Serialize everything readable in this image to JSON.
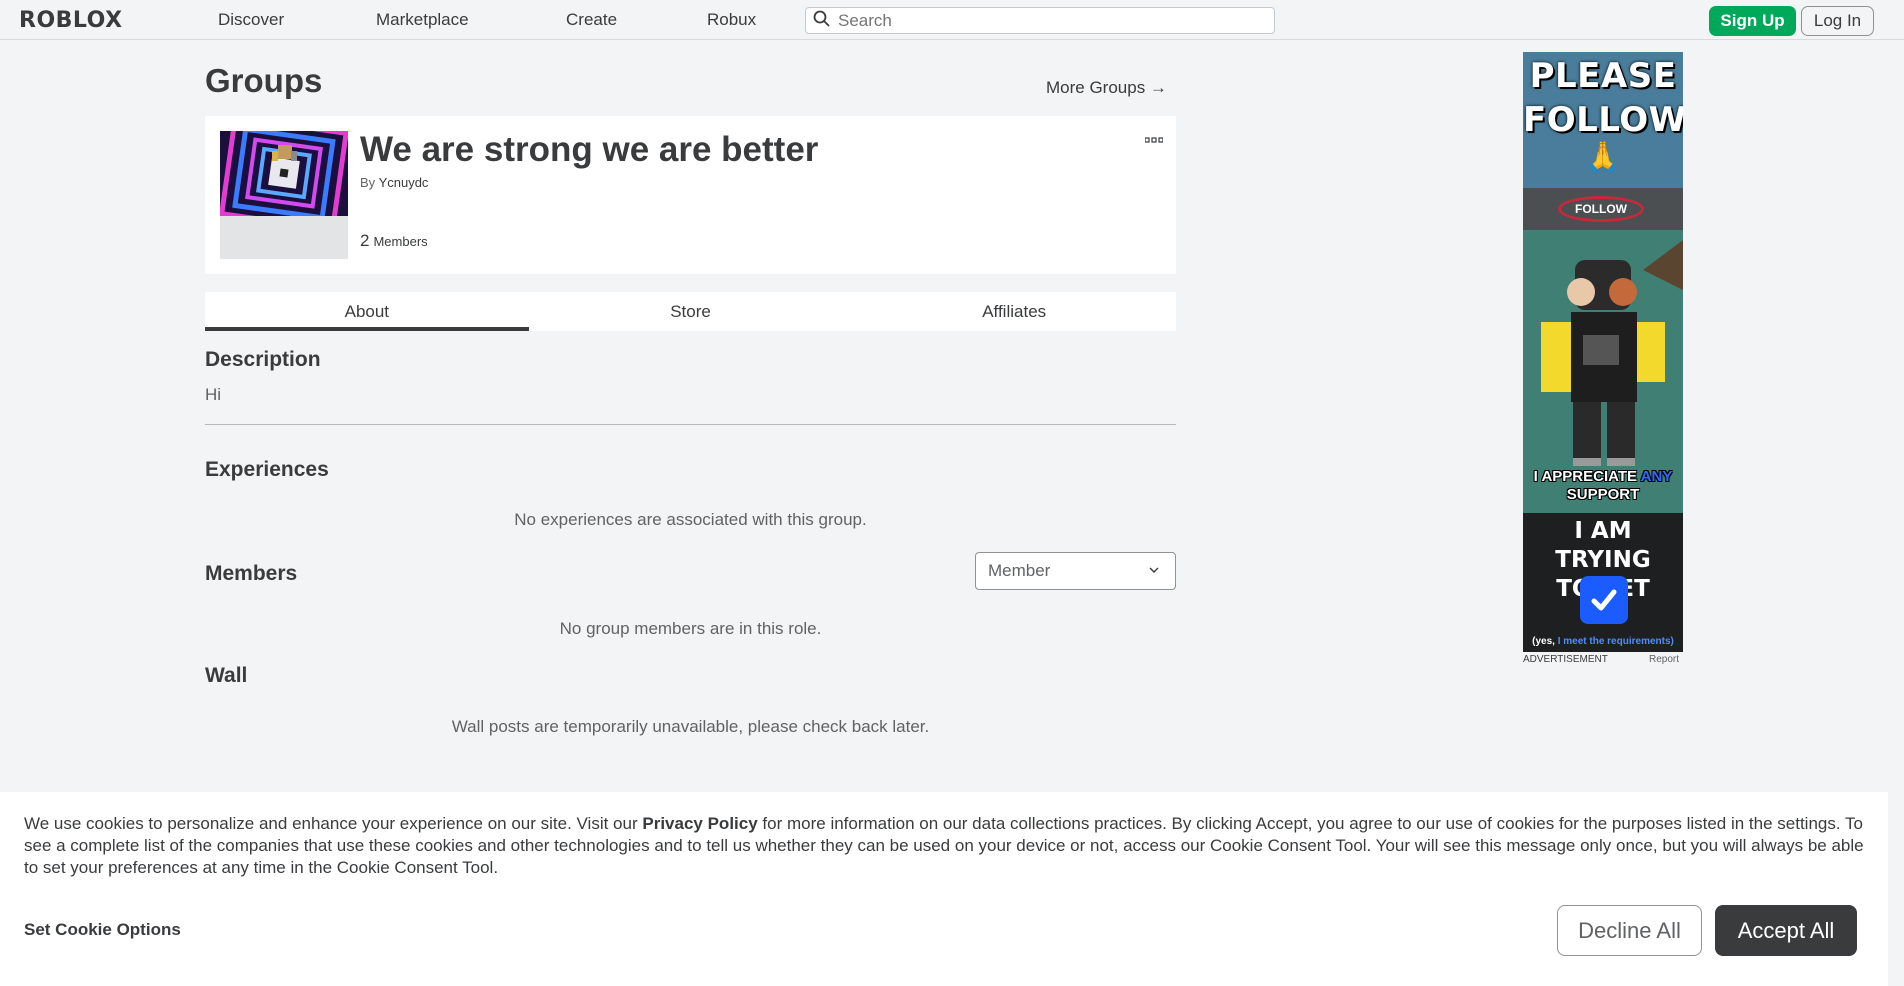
{
  "header": {
    "logo": "ROBLOX",
    "nav": [
      "Discover",
      "Marketplace",
      "Create",
      "Robux"
    ],
    "search_placeholder": "Search",
    "signup_label": "Sign Up",
    "login_label": "Log In"
  },
  "page": {
    "title": "Groups",
    "more_groups_label": "More Groups →"
  },
  "group": {
    "name": "We are strong we are better",
    "by_prefix": "By",
    "owner": "Ycnuydc",
    "member_count": "2",
    "member_word": "Members",
    "more_icon": "ellipsis-icon"
  },
  "tabs": [
    "About",
    "Store",
    "Affiliates"
  ],
  "about": {
    "description_title": "Description",
    "description_text": "Hi",
    "experiences_title": "Experiences",
    "experiences_empty": "No experiences are associated with this group.",
    "members_title": "Members",
    "role_selected": "Member",
    "members_empty": "No group members are in this role.",
    "wall_title": "Wall",
    "wall_message": "Wall posts are temporarily unavailable, please check back later."
  },
  "ad": {
    "line1": "PLEASE",
    "line2": "FOLLOW",
    "emoji": "🙏",
    "follow_button": "FOLLOW",
    "appreciate_a": "I APPRECIATE",
    "appreciate_any": "ANY",
    "appreciate_b": "SUPPORT",
    "trying_1": "I AM TRYING",
    "trying_2": "TO GET",
    "yes_prefix": "(yes,",
    "yes_blue": "I meet the requirements)",
    "label": "ADVERTISEMENT",
    "report": "Report"
  },
  "cookie": {
    "text_a": "We use cookies to personalize and enhance your experience on our site. Visit our",
    "privacy_link": "Privacy Policy",
    "text_b": "for more information on our data collections practices. By clicking Accept, you agree to our use of cookies for the purposes listed in the settings. To see a complete list of the companies that use these cookies and other technologies and to tell us whether they can be used on your device or not, access our Cookie Consent Tool. Your will see this message only once, but you will always be able to set your preferences at any time in the Cookie Consent Tool.",
    "options_label": "Set Cookie Options",
    "decline_label": "Decline All",
    "accept_label": "Accept All"
  },
  "colors": {
    "accent_green": "#00a85a",
    "text_dark": "#393b3d",
    "background": "#f2f4f5"
  }
}
